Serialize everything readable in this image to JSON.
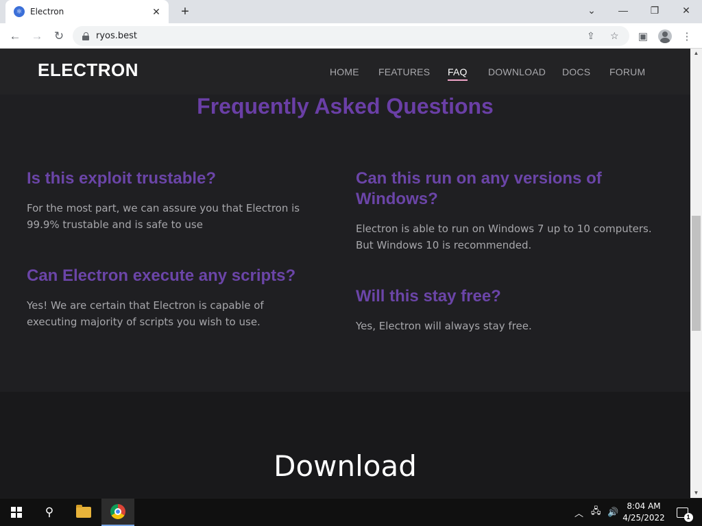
{
  "browser": {
    "tab_title": "Electron",
    "tab_close": "✕",
    "new_tab": "+",
    "url": "ryos.best",
    "window_controls": {
      "dropdown": "⌄",
      "minimize": "—",
      "restore": "❐",
      "close": "✕"
    }
  },
  "site": {
    "logo": "ELECTRON",
    "nav": [
      {
        "label": "HOME",
        "active": false
      },
      {
        "label": "FEATURES",
        "active": false
      },
      {
        "label": "FAQ",
        "active": true
      },
      {
        "label": "DOWNLOAD",
        "active": false
      },
      {
        "label": "DOCS",
        "active": false
      },
      {
        "label": "FORUM",
        "active": false
      }
    ],
    "faq": {
      "title": "Frequently Asked Questions",
      "items": [
        {
          "question": "Is this exploit trustable?",
          "answer": "For the most part, we can assure you that Electron is 99.9% trustable and is safe to use"
        },
        {
          "question": "Can this run on any versions of Windows?",
          "answer": "Electron is able to run on Windows 7 up to 10 computers. But Windows 10 is recommended."
        },
        {
          "question": "Can Electron execute any scripts?",
          "answer": "Yes! We are certain that Electron is capable of executing majority of scripts you wish to use."
        },
        {
          "question": "Will this stay free?",
          "answer": "Yes, Electron will always stay free."
        }
      ]
    },
    "download": {
      "title": "Download"
    }
  },
  "taskbar": {
    "time": "8:04 AM",
    "date": "4/25/2022",
    "notification_count": "1"
  },
  "colors": {
    "accent_purple": "#6b45a8",
    "nav_active_underline": "#f0a5c9",
    "page_bg": "#1f1f22"
  }
}
